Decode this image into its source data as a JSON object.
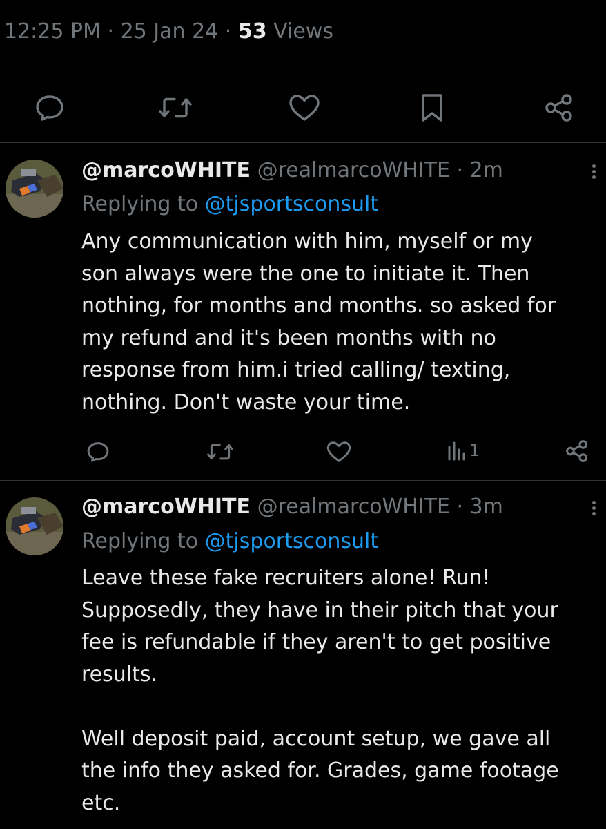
{
  "post_meta": {
    "time": "12:25 PM",
    "sep1": " · ",
    "date": "25 Jan 24",
    "sep2": " · ",
    "views_count": "53",
    "views_label": " Views"
  },
  "main_actions": {
    "icons": [
      "reply-icon",
      "repost-icon",
      "like-icon",
      "bookmark-icon",
      "share-icon"
    ]
  },
  "replies": [
    {
      "display_name": "@marcoWHITE",
      "handle": "@realmarcoWHITE",
      "sep": " · ",
      "time": "2m",
      "replying_label": "Replying to ",
      "replying_to": "@tjsportsconsult",
      "text": "Any communication with him, myself or my\nson always were the one to initiate it. Then\nnothing, for months and months. so asked for\nmy refund and it's been months with no\nresponse from him.i tried calling/ texting,\nnothing. Don't waste your time.",
      "views": "1"
    },
    {
      "display_name": "@marcoWHITE",
      "handle": "@realmarcoWHITE",
      "sep": " · ",
      "time": "3m",
      "replying_label": "Replying to ",
      "replying_to": "@tjsportsconsult",
      "text": "Leave these fake recruiters alone! Run!\nSupposedly, they have in their pitch that your\nfee is refundable if they aren't to get positive\nresults.\n\nWell deposit paid, account setup, we gave all\nthe info they asked for. Grades, game footage\netc."
    }
  ],
  "colors": {
    "background": "#000000",
    "text": "#e7e9ea",
    "muted": "#71767b",
    "link": "#1d9bf0",
    "divider": "#2f3336"
  }
}
